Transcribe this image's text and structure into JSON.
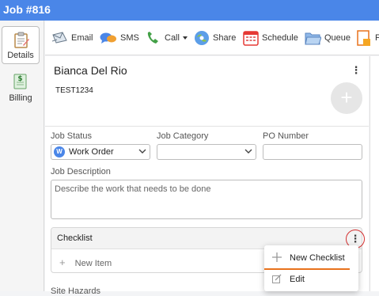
{
  "window": {
    "title": "Job #816"
  },
  "sidebar": {
    "items": [
      {
        "label": "Details",
        "icon": "clipboard-icon"
      },
      {
        "label": "Billing",
        "icon": "billing-icon"
      }
    ]
  },
  "toolbar": {
    "items": [
      {
        "label": "Email",
        "icon": "email-icon"
      },
      {
        "label": "SMS",
        "icon": "sms-icon"
      },
      {
        "label": "Call",
        "icon": "phone-icon",
        "dropdown": true
      },
      {
        "label": "Share",
        "icon": "share-icon"
      },
      {
        "label": "Schedule",
        "icon": "calendar-icon"
      },
      {
        "label": "Queue",
        "icon": "folder-icon"
      },
      {
        "label": "F",
        "icon": "form-icon"
      }
    ]
  },
  "customer": {
    "name": "Bianca Del Rio",
    "reference": "TEST1234"
  },
  "fields": {
    "job_status": {
      "label": "Job Status",
      "value": "Work Order",
      "badge": "W",
      "badge_color": "#4a86e8"
    },
    "job_category": {
      "label": "Job Category",
      "value": ""
    },
    "po_number": {
      "label": "PO Number",
      "value": ""
    },
    "job_description": {
      "label": "Job Description",
      "placeholder": "Describe the work that needs to be done"
    }
  },
  "checklist": {
    "title": "Checklist",
    "new_item": "New Item"
  },
  "menu": {
    "items": [
      {
        "label": "New Checklist",
        "icon": "plus-icon"
      },
      {
        "label": "Edit",
        "icon": "edit-icon"
      }
    ]
  },
  "site_hazards": {
    "label": "Site Hazards"
  },
  "colors": {
    "accent": "#4a86e8",
    "highlight": "#d32f2f",
    "menu_underline": "#e8721c"
  }
}
